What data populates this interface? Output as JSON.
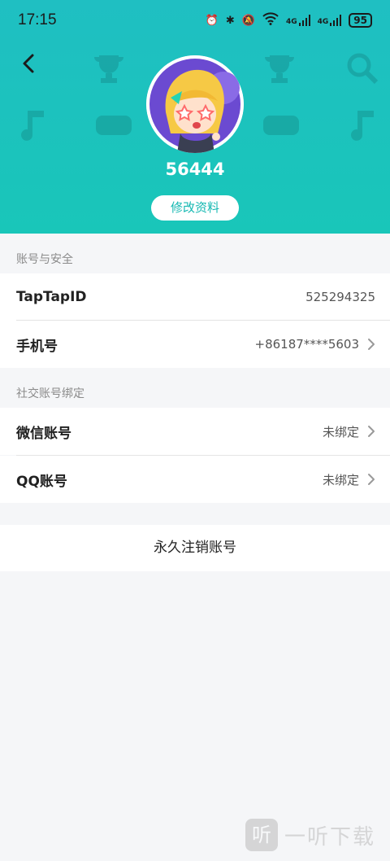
{
  "status_bar": {
    "time": "17:15",
    "network_label_1": "4G",
    "network_label_2": "4G",
    "battery": "95"
  },
  "header": {
    "username": "56444",
    "edit_profile_label": "修改资料",
    "bg_color": "#1fc1be"
  },
  "section_account": {
    "label": "账号与安全",
    "rows": [
      {
        "title": "TapTapID",
        "value": "525294325"
      },
      {
        "title": "手机号",
        "value": "+86187****5603"
      }
    ]
  },
  "section_social": {
    "label": "社交账号绑定",
    "rows": [
      {
        "title": "微信账号",
        "value": "未绑定"
      },
      {
        "title": "QQ账号",
        "value": "未绑定"
      }
    ]
  },
  "delete_account_label": "永久注销账号",
  "watermark": {
    "glyph": "听",
    "text": "一听下载"
  }
}
